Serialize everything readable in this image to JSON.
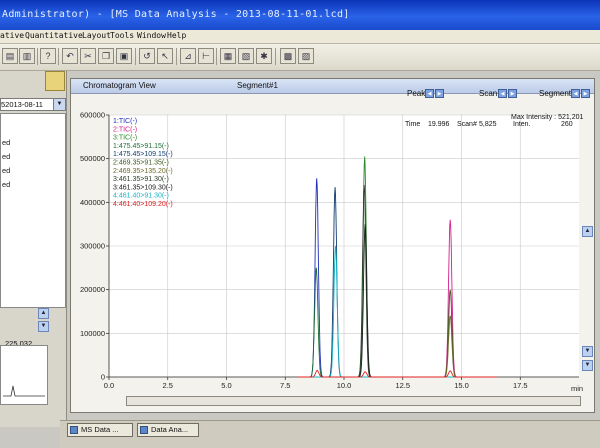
{
  "titlebar": {
    "text": "Administrator) - [MS Data Analysis - 2013-08-11-01.lcd]"
  },
  "menu": [
    "ative",
    "Quantitative",
    "Layout",
    "Tools",
    "Window",
    "Help"
  ],
  "left_panel": {
    "date_value": "52013-08-11",
    "files": [
      "ed",
      "ed",
      "ed",
      "ed"
    ],
    "mini_value": "225,032"
  },
  "chrom_window": {
    "title": "Chromatogram View",
    "segment_title": "Segment#1",
    "peak_label": "Peak",
    "scan_label": "Scan",
    "segment_label": "Segment",
    "max_intensity": "Max Intensity : 521,201",
    "time_label": "Time",
    "time_value": "19.996",
    "scan_no_label": "Scan#",
    "scan_no_value": "5,825",
    "inten_label": "Inten.",
    "inten_value": "260",
    "x_unit": "min"
  },
  "taskbar": {
    "tab1": "MS Data ...",
    "tab2": "Data Ana..."
  },
  "chart_data": {
    "type": "line",
    "xlim": [
      0,
      20
    ],
    "ylim": [
      0,
      600000
    ],
    "x_ticks": [
      0.0,
      2.5,
      5.0,
      7.5,
      10.0,
      12.5,
      15.0,
      17.5
    ],
    "x_tick_labels": [
      "0.0",
      "2.5",
      "5.0",
      "7.5",
      "10.0",
      "12.5",
      "15.0",
      "17.5"
    ],
    "y_ticks": [
      0,
      100000,
      200000,
      300000,
      400000,
      500000,
      600000
    ],
    "y_tick_labels": [
      "0",
      "100000",
      "200000",
      "300000",
      "400000",
      "500000",
      "600000"
    ],
    "grid": true,
    "legend_position": "top-left",
    "series": [
      {
        "name": "1:TIC(-)",
        "color": "#1f2fb8",
        "peaks": [
          [
            8.84,
            455000
          ]
        ]
      },
      {
        "name": "2:TIC(-)",
        "color": "#d41f8f",
        "peaks": [
          [
            14.52,
            360000
          ]
        ]
      },
      {
        "name": "3:TIC(-)",
        "color": "#2a8a2a",
        "peaks": [
          [
            10.88,
            505000
          ]
        ]
      },
      {
        "name": "1:475.45>91.15(-)",
        "color": "#1c6e34",
        "peaks": [
          [
            8.82,
            250000
          ]
        ]
      },
      {
        "name": "1:475.45>109.15(-)",
        "color": "#103c6e",
        "peaks": [
          [
            9.62,
            435000
          ]
        ]
      },
      {
        "name": "2:469.35>91.35(-)",
        "color": "#3d5a1a",
        "peaks": [
          [
            14.52,
            200000
          ]
        ]
      },
      {
        "name": "2:469.35>135.20(-)",
        "color": "#6b6b2a",
        "peaks": [
          [
            14.52,
            140000
          ]
        ]
      },
      {
        "name": "3:461.35>91.30(-)",
        "color": "#2b3d2b",
        "peaks": [
          [
            10.86,
            440000
          ]
        ]
      },
      {
        "name": "3:461.35>109.30(-)",
        "color": "#1a1a1a",
        "peaks": [
          [
            10.9,
            350000
          ]
        ]
      },
      {
        "name": "4:461.40>91.30(-)",
        "color": "#17b5c4",
        "peaks": [
          [
            9.64,
            300000
          ]
        ]
      },
      {
        "name": "4:461.40>109.20(-)",
        "color": "#e02020",
        "peaks": [
          [
            8.86,
            15000
          ],
          [
            10.9,
            12000
          ],
          [
            14.52,
            14000
          ]
        ]
      }
    ]
  }
}
